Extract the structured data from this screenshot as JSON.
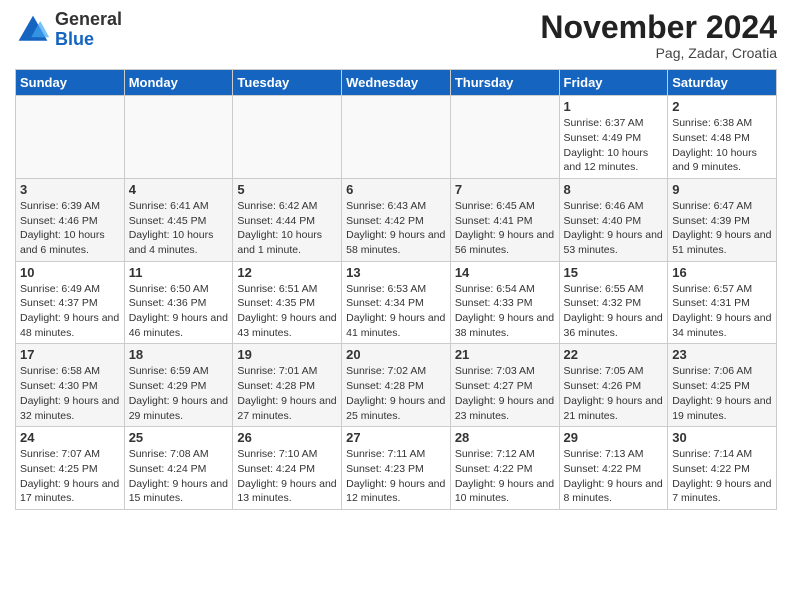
{
  "header": {
    "logo_general": "General",
    "logo_blue": "Blue",
    "month_title": "November 2024",
    "subtitle": "Pag, Zadar, Croatia"
  },
  "days_of_week": [
    "Sunday",
    "Monday",
    "Tuesday",
    "Wednesday",
    "Thursday",
    "Friday",
    "Saturday"
  ],
  "weeks": [
    [
      {
        "day": "",
        "info": ""
      },
      {
        "day": "",
        "info": ""
      },
      {
        "day": "",
        "info": ""
      },
      {
        "day": "",
        "info": ""
      },
      {
        "day": "",
        "info": ""
      },
      {
        "day": "1",
        "info": "Sunrise: 6:37 AM\nSunset: 4:49 PM\nDaylight: 10 hours and 12 minutes."
      },
      {
        "day": "2",
        "info": "Sunrise: 6:38 AM\nSunset: 4:48 PM\nDaylight: 10 hours and 9 minutes."
      }
    ],
    [
      {
        "day": "3",
        "info": "Sunrise: 6:39 AM\nSunset: 4:46 PM\nDaylight: 10 hours and 6 minutes."
      },
      {
        "day": "4",
        "info": "Sunrise: 6:41 AM\nSunset: 4:45 PM\nDaylight: 10 hours and 4 minutes."
      },
      {
        "day": "5",
        "info": "Sunrise: 6:42 AM\nSunset: 4:44 PM\nDaylight: 10 hours and 1 minute."
      },
      {
        "day": "6",
        "info": "Sunrise: 6:43 AM\nSunset: 4:42 PM\nDaylight: 9 hours and 58 minutes."
      },
      {
        "day": "7",
        "info": "Sunrise: 6:45 AM\nSunset: 4:41 PM\nDaylight: 9 hours and 56 minutes."
      },
      {
        "day": "8",
        "info": "Sunrise: 6:46 AM\nSunset: 4:40 PM\nDaylight: 9 hours and 53 minutes."
      },
      {
        "day": "9",
        "info": "Sunrise: 6:47 AM\nSunset: 4:39 PM\nDaylight: 9 hours and 51 minutes."
      }
    ],
    [
      {
        "day": "10",
        "info": "Sunrise: 6:49 AM\nSunset: 4:37 PM\nDaylight: 9 hours and 48 minutes."
      },
      {
        "day": "11",
        "info": "Sunrise: 6:50 AM\nSunset: 4:36 PM\nDaylight: 9 hours and 46 minutes."
      },
      {
        "day": "12",
        "info": "Sunrise: 6:51 AM\nSunset: 4:35 PM\nDaylight: 9 hours and 43 minutes."
      },
      {
        "day": "13",
        "info": "Sunrise: 6:53 AM\nSunset: 4:34 PM\nDaylight: 9 hours and 41 minutes."
      },
      {
        "day": "14",
        "info": "Sunrise: 6:54 AM\nSunset: 4:33 PM\nDaylight: 9 hours and 38 minutes."
      },
      {
        "day": "15",
        "info": "Sunrise: 6:55 AM\nSunset: 4:32 PM\nDaylight: 9 hours and 36 minutes."
      },
      {
        "day": "16",
        "info": "Sunrise: 6:57 AM\nSunset: 4:31 PM\nDaylight: 9 hours and 34 minutes."
      }
    ],
    [
      {
        "day": "17",
        "info": "Sunrise: 6:58 AM\nSunset: 4:30 PM\nDaylight: 9 hours and 32 minutes."
      },
      {
        "day": "18",
        "info": "Sunrise: 6:59 AM\nSunset: 4:29 PM\nDaylight: 9 hours and 29 minutes."
      },
      {
        "day": "19",
        "info": "Sunrise: 7:01 AM\nSunset: 4:28 PM\nDaylight: 9 hours and 27 minutes."
      },
      {
        "day": "20",
        "info": "Sunrise: 7:02 AM\nSunset: 4:28 PM\nDaylight: 9 hours and 25 minutes."
      },
      {
        "day": "21",
        "info": "Sunrise: 7:03 AM\nSunset: 4:27 PM\nDaylight: 9 hours and 23 minutes."
      },
      {
        "day": "22",
        "info": "Sunrise: 7:05 AM\nSunset: 4:26 PM\nDaylight: 9 hours and 21 minutes."
      },
      {
        "day": "23",
        "info": "Sunrise: 7:06 AM\nSunset: 4:25 PM\nDaylight: 9 hours and 19 minutes."
      }
    ],
    [
      {
        "day": "24",
        "info": "Sunrise: 7:07 AM\nSunset: 4:25 PM\nDaylight: 9 hours and 17 minutes."
      },
      {
        "day": "25",
        "info": "Sunrise: 7:08 AM\nSunset: 4:24 PM\nDaylight: 9 hours and 15 minutes."
      },
      {
        "day": "26",
        "info": "Sunrise: 7:10 AM\nSunset: 4:24 PM\nDaylight: 9 hours and 13 minutes."
      },
      {
        "day": "27",
        "info": "Sunrise: 7:11 AM\nSunset: 4:23 PM\nDaylight: 9 hours and 12 minutes."
      },
      {
        "day": "28",
        "info": "Sunrise: 7:12 AM\nSunset: 4:22 PM\nDaylight: 9 hours and 10 minutes."
      },
      {
        "day": "29",
        "info": "Sunrise: 7:13 AM\nSunset: 4:22 PM\nDaylight: 9 hours and 8 minutes."
      },
      {
        "day": "30",
        "info": "Sunrise: 7:14 AM\nSunset: 4:22 PM\nDaylight: 9 hours and 7 minutes."
      }
    ]
  ]
}
